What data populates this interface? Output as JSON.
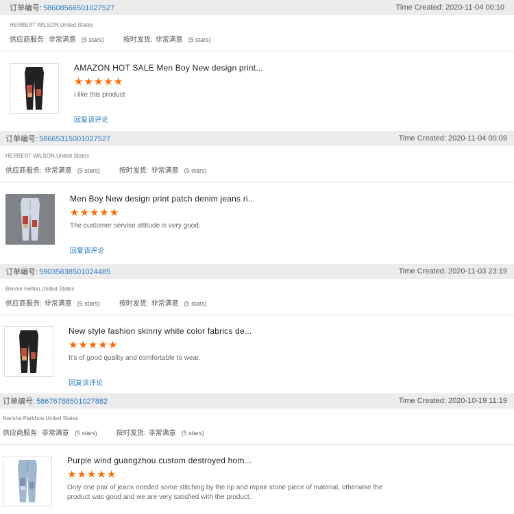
{
  "labels": {
    "order_prefix": "订单编号:",
    "supplier_service": "供应商服务:",
    "on_time": "按时发货:",
    "reply": "回复该评论"
  },
  "reviews": [
    {
      "order_number": "58608566501027527",
      "time_created": "Time Created: 2020-11-04 00:10",
      "buyer": "HERBERT WILSON,United States",
      "supplier_rating": "非常满意",
      "supplier_stars": "(5 stars)",
      "ontime_rating": "非常满意",
      "ontime_stars": "(5 stars)",
      "product_title": "AMAZON HOT SALE Men Boy New design print...",
      "stars": 5,
      "comment": "i like this product"
    },
    {
      "order_number": "58665315001027527",
      "time_created": "Time Created: 2020-11-04 00:09",
      "buyer": "HERBERT WILSON,United States",
      "supplier_rating": "非常满意",
      "supplier_stars": "(5 stars)",
      "ontime_rating": "非常满意",
      "ontime_stars": "(5 stars)",
      "product_title": "Men Boy New design print patch denim jeans ri...",
      "stars": 5,
      "comment": "The customer servise attitude is very good."
    },
    {
      "order_number": "59035638501024485",
      "time_created": "Time Created: 2020-11-03 23:19",
      "buyer": "Bennie Helton,United States",
      "supplier_rating": "非常满意",
      "supplier_stars": "(5 stars)",
      "ontime_rating": "非常满意",
      "ontime_stars": "(5 stars)",
      "product_title": "New style fashion skinny white color fabrics de...",
      "stars": 5,
      "comment": "It's of good quality and comfortable to wear."
    },
    {
      "order_number": "58676788501027882",
      "time_created": "Time Created: 2020-10-19 11:19",
      "buyer": "Narisha Parbhoo,United States",
      "supplier_rating": "非常满意",
      "supplier_stars": "(5 stars)",
      "ontime_rating": "非常满意",
      "ontime_stars": "(5 stars)",
      "product_title": "Purple wind guangzhou custom destroyed hom...",
      "stars": 5,
      "comment": "Only one pair of jeans needed some stitching by the rip and repair stone piece of material, otherwise the product was good and we are very satisfied with the product."
    }
  ],
  "colors": {
    "star": "#ff6a00",
    "link": "#2a7ac4",
    "header_bg": "#ececec"
  }
}
